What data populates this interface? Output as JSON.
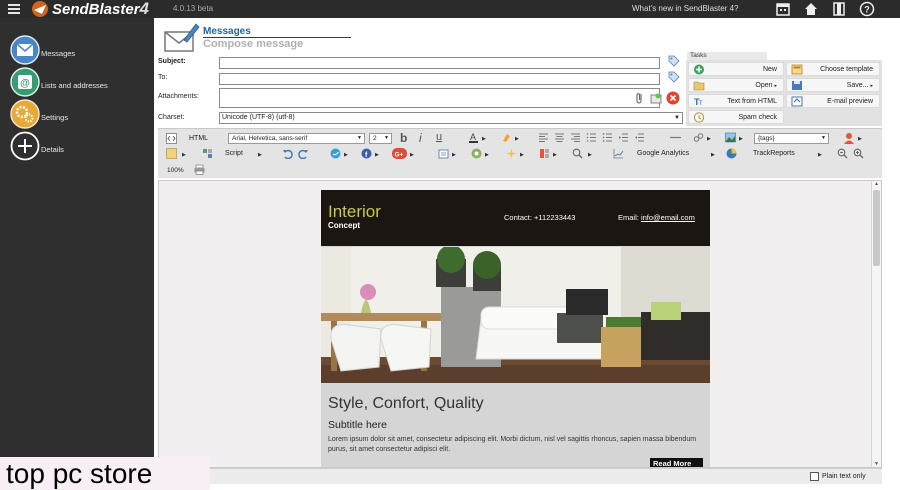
{
  "app": {
    "name": "SendBlaster",
    "version_mark": "4",
    "version": "4.0.13 beta",
    "whats_new": "What's new in SendBlaster 4?"
  },
  "sidebar": {
    "items": [
      {
        "label": "Messages",
        "icon": "envelope-icon"
      },
      {
        "label": "Lists and addresses",
        "icon": "address-book-icon"
      },
      {
        "label": "Settings",
        "icon": "gears-icon"
      },
      {
        "label": "Details",
        "icon": "plus-circle-icon"
      }
    ]
  },
  "header": {
    "title": "Messages",
    "subtitle": "Compose message"
  },
  "form": {
    "subject_label": "Subject:",
    "to_label": "To:",
    "attachments_label": "Attachments:",
    "charset_label": "Charset:",
    "charset_value": "Unicode (UTF-8)     (utf-8)"
  },
  "tasks": {
    "label": "Tasks",
    "items": [
      {
        "label": "New"
      },
      {
        "label": "Choose template"
      },
      {
        "label": "Open"
      },
      {
        "label": "Save..."
      },
      {
        "label": "Text from HTML"
      },
      {
        "label": "E-mail preview"
      },
      {
        "label": "Spam check"
      }
    ]
  },
  "toolbar": {
    "html_label": "HTML",
    "font_family": "Arial, Helvetica, sans-serif",
    "font_size": "2",
    "tags": "{tags}",
    "script_label": "Script",
    "google_analytics": "Google Analytics",
    "track_reports": "TrackReports",
    "zoom": "100%"
  },
  "email": {
    "brand": "Interior",
    "concept": "Concept",
    "contact": "Contact: +112233443",
    "email_label": "Email:",
    "email_link": "info@email.com",
    "headline": "Style, Confort, Quality",
    "subtitle": "Subtitle here",
    "body": "Lorem ipsum dolor sit amet, consectetur adipiscing elit. Morbi dictum, nisl vel sagittis rhoncus, sapien massa bibendum purus, sit amet consectetur adipisci elit.",
    "read_more": "Read More"
  },
  "statusbar": {
    "plain_text_label": "Plain text only",
    "plain_text_checked": false
  },
  "overlay": {
    "watermark": "top pc store"
  },
  "colors": {
    "accent_blue": "#1f63a8",
    "sidebar_bg": "#2f2f2f",
    "email_header_bg": "#1b1612",
    "brand_yellow": "#c8c94a"
  }
}
